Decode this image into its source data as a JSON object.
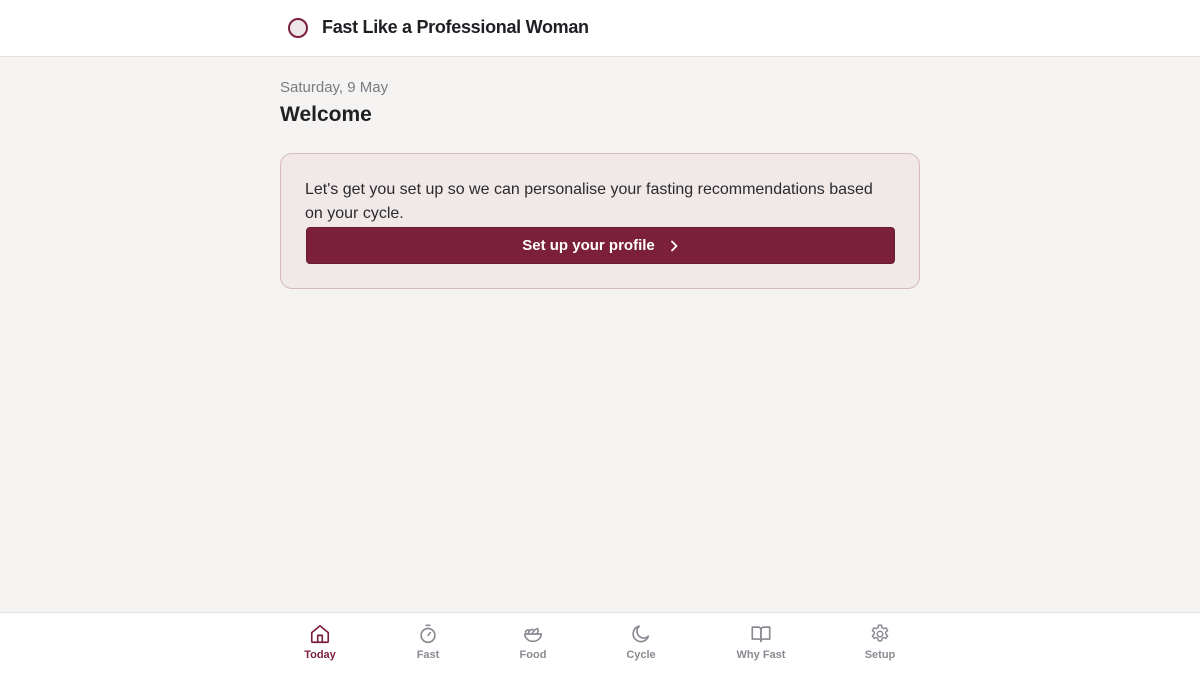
{
  "header": {
    "title": "Fast Like a Professional Woman",
    "logo_icon": "circle-logo-icon"
  },
  "main": {
    "date": "Saturday, 9 May",
    "heading": "Welcome",
    "setup_card": {
      "message": "Let's get you set up so we can personalise your fasting recommendations based on your cycle.",
      "button_label": "Set up your profile",
      "button_icon": "chevron-right-icon"
    }
  },
  "nav": {
    "items": [
      {
        "label": "Today",
        "icon": "home-icon",
        "active": true
      },
      {
        "label": "Fast",
        "icon": "timer-icon",
        "active": false
      },
      {
        "label": "Food",
        "icon": "salad-bowl-icon",
        "active": false
      },
      {
        "label": "Cycle",
        "icon": "moon-icon",
        "active": false
      },
      {
        "label": "Why Fast",
        "icon": "book-open-icon",
        "active": false
      },
      {
        "label": "Setup",
        "icon": "gear-icon",
        "active": false
      }
    ]
  },
  "colors": {
    "accent": "#7b1f3a",
    "background": "#f5f3f2",
    "card_background": "#f0e9e7",
    "card_border": "#d6b9c0",
    "inactive_nav": "#8a8a92"
  }
}
